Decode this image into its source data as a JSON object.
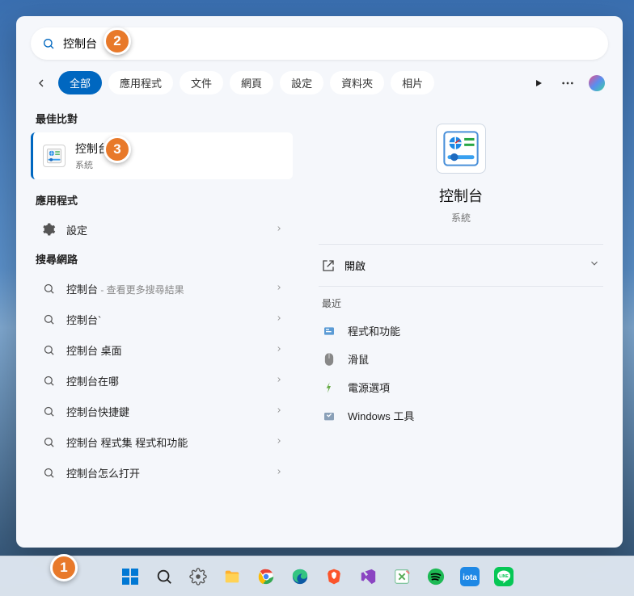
{
  "search": {
    "value": "控制台"
  },
  "tabs": {
    "items": [
      "全部",
      "應用程式",
      "文件",
      "網頁",
      "設定",
      "資料夾",
      "相片"
    ],
    "active": 0
  },
  "sections": {
    "best_match": "最佳比對",
    "apps": "應用程式",
    "web": "搜尋網路",
    "recent": "最近"
  },
  "best_match": {
    "title": "控制台",
    "subtitle": "系統"
  },
  "apps_list": [
    {
      "label": "設定",
      "icon": "gear"
    }
  ],
  "web_list": [
    {
      "label": "控制台",
      "hint": " - 查看更多搜尋結果"
    },
    {
      "label": "控制台`"
    },
    {
      "label": "控制台 桌面"
    },
    {
      "label": "控制台在哪"
    },
    {
      "label": "控制台快捷鍵"
    },
    {
      "label": "控制台 程式集 程式和功能"
    },
    {
      "label": "控制台怎么打开"
    }
  ],
  "preview": {
    "title": "控制台",
    "subtitle": "系統",
    "open_label": "開啟"
  },
  "recent_list": [
    {
      "label": "程式和功能",
      "icon": "programs"
    },
    {
      "label": "滑鼠",
      "icon": "mouse"
    },
    {
      "label": "電源選項",
      "icon": "power"
    },
    {
      "label": "Windows 工具",
      "icon": "tools"
    }
  ],
  "step_badges": {
    "1": "1",
    "2": "2",
    "3": "3"
  }
}
